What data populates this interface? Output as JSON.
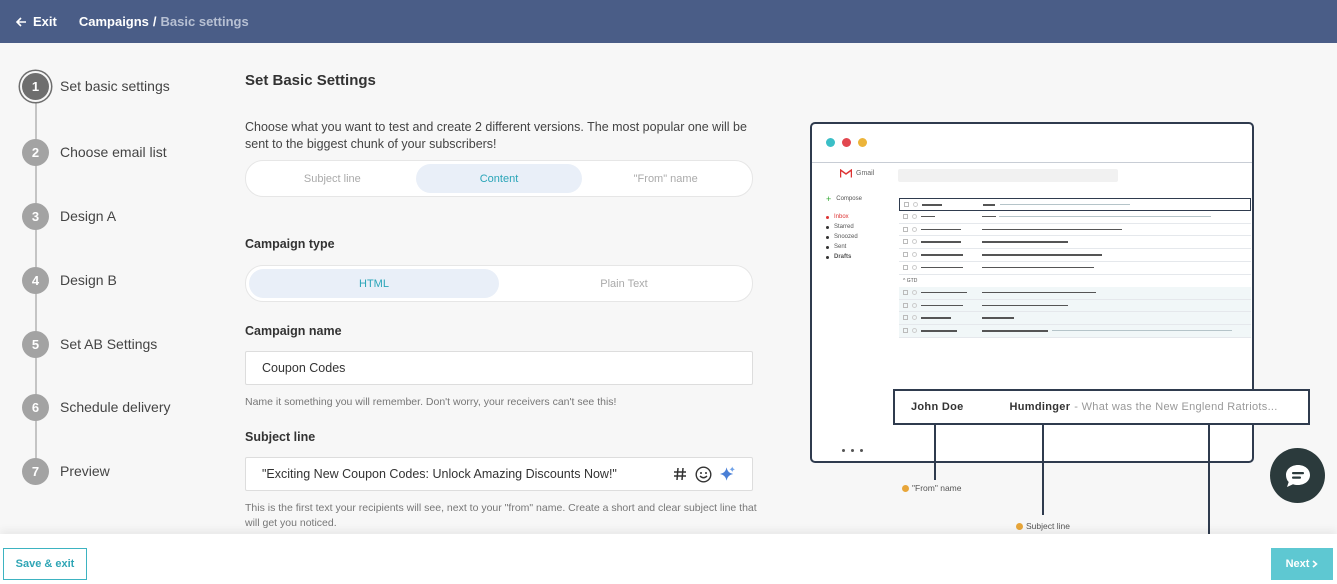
{
  "header": {
    "exit_label": "Exit",
    "breadcrumb_root": "Campaigns",
    "breadcrumb_sep": "/",
    "breadcrumb_current": "Basic settings"
  },
  "steps": [
    {
      "num": "1",
      "label": "Set basic settings"
    },
    {
      "num": "2",
      "label": "Choose email list"
    },
    {
      "num": "3",
      "label": "Design A"
    },
    {
      "num": "4",
      "label": "Design B"
    },
    {
      "num": "5",
      "label": "Set AB Settings"
    },
    {
      "num": "6",
      "label": "Schedule delivery"
    },
    {
      "num": "7",
      "label": "Preview"
    }
  ],
  "form": {
    "title": "Set Basic Settings",
    "description": "Choose what you want to test and create 2 different versions. The most popular one will be sent to the biggest chunk of your subscribers!",
    "test_options": [
      "Subject line",
      "Content",
      "\"From\" name"
    ],
    "test_selected": "Content",
    "campaign_type_label": "Campaign type",
    "campaign_types": [
      "HTML",
      "Plain Text"
    ],
    "campaign_type_selected": "HTML",
    "campaign_name_label": "Campaign name",
    "campaign_name_value": "Coupon Codes",
    "campaign_name_hint": "Name it something you will remember. Don't worry, your receivers can't see this!",
    "subject_label": "Subject line",
    "subject_value": "\"Exciting New Coupon Codes: Unlock Amazing Discounts Now!\"",
    "subject_hint": "This is the first text your recipients will see, next to your \"from\" name. Create a short and clear subject line that will get you noticed."
  },
  "mockup": {
    "app_name": "Gmail",
    "compose_label": "Compose",
    "folders": [
      "Inbox",
      "Starred",
      "Snoozed",
      "Sent",
      "Drafts"
    ],
    "group_label": "GTD",
    "callout_from": "John Doe",
    "callout_sender": "Humdinger",
    "callout_preview": "- What was the New Englend Ratriots...",
    "annotation_from": "\"From\" name",
    "annotation_subject": "Subject line"
  },
  "footer": {
    "save_label": "Save & exit",
    "next_label": "Next"
  },
  "colors": {
    "topbar": "#4a5d87",
    "accent": "#3db3c1",
    "selected_bg": "#e9eff8",
    "dot_teal": "#3bbfc7",
    "dot_red": "#e2474f",
    "dot_yellow": "#ecb43a"
  }
}
